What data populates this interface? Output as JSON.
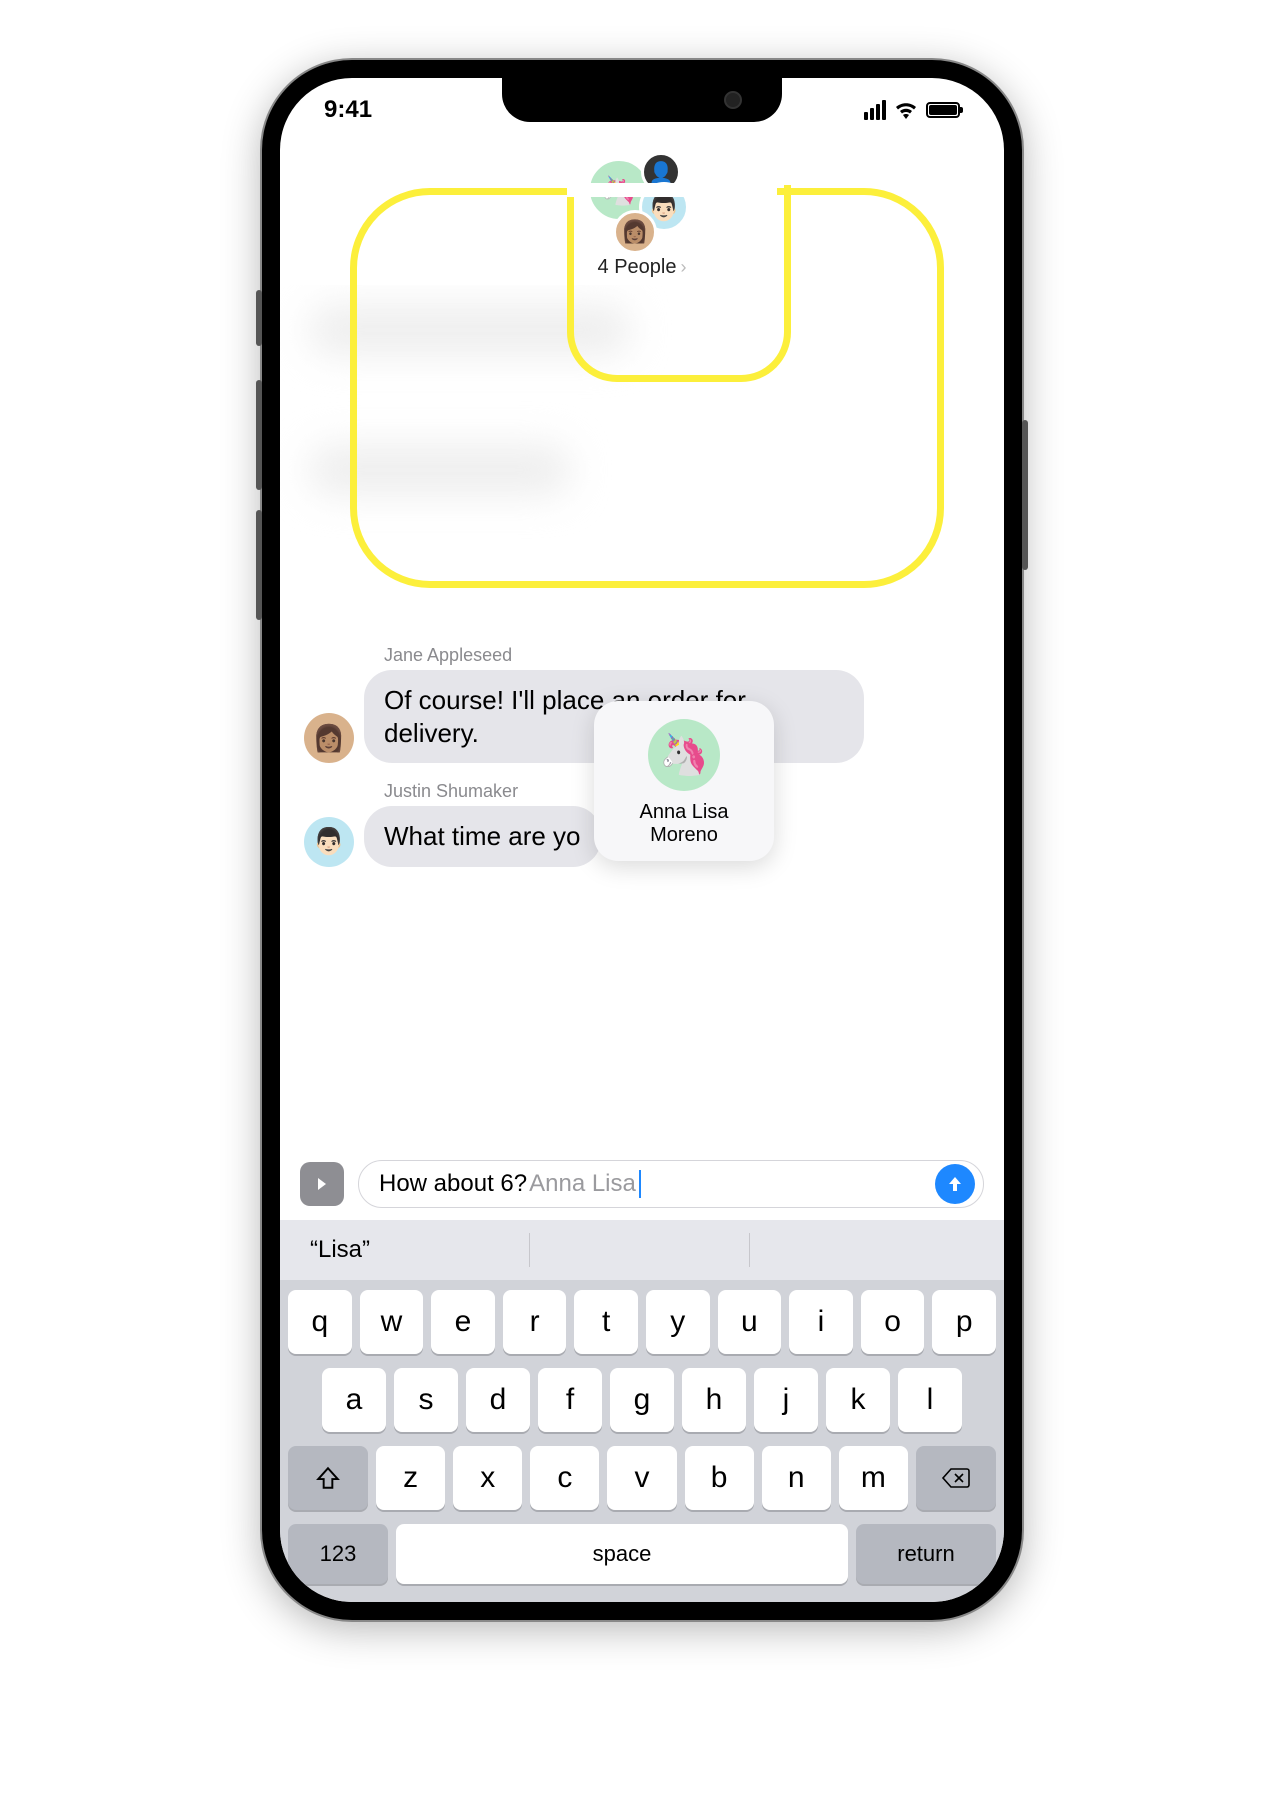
{
  "status": {
    "time": "9:41"
  },
  "header": {
    "group_label": "4 People",
    "avatars": {
      "big": "🦄",
      "small1": "👤",
      "small2": "👨🏻",
      "small3": "👩🏽"
    }
  },
  "messages": [
    {
      "sender": "Jane Appleseed",
      "avatar_emoji": "👩🏽",
      "text": "Of course! I'll place an order for delivery."
    },
    {
      "sender": "Justin Shumaker",
      "avatar_emoji": "👨🏻",
      "text": "What time are yo"
    }
  ],
  "mention_popup": {
    "avatar_emoji": "🦄",
    "name": "Anna Lisa Moreno"
  },
  "compose": {
    "typed_text": "How about 6? ",
    "mention_text": "Anna Lisa",
    "send_icon": "arrow-up"
  },
  "suggestions": {
    "item1": "“Lisa”"
  },
  "keyboard": {
    "row1": [
      "q",
      "w",
      "e",
      "r",
      "t",
      "y",
      "u",
      "i",
      "o",
      "p"
    ],
    "row2": [
      "a",
      "s",
      "d",
      "f",
      "g",
      "h",
      "j",
      "k",
      "l"
    ],
    "row3": [
      "z",
      "x",
      "c",
      "v",
      "b",
      "n",
      "m"
    ],
    "shift": "⇧",
    "backspace": "⌫",
    "numbers": "123",
    "space": "space",
    "return": "return"
  }
}
